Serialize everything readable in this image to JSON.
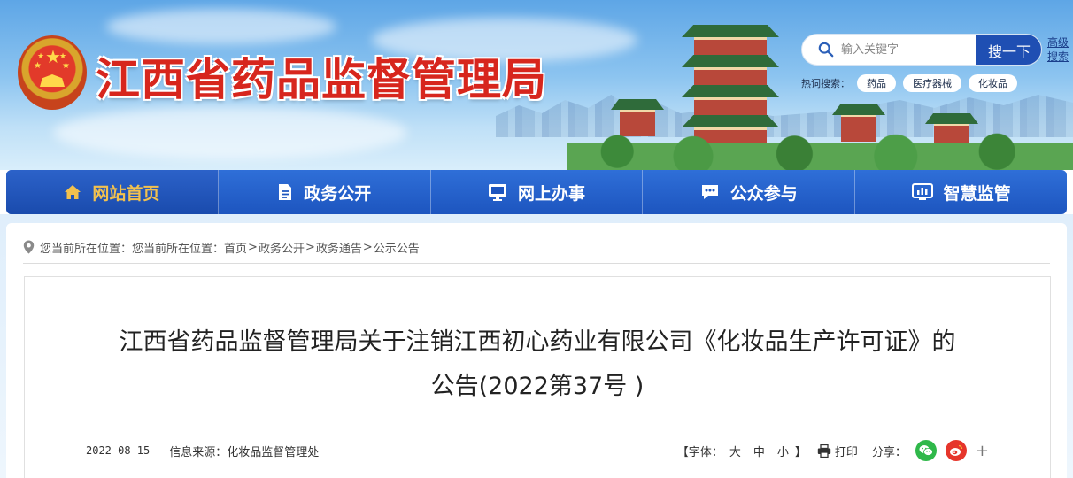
{
  "header": {
    "site_title": "江西省药品监督管理局",
    "emblem_icon": "national-emblem-icon",
    "search": {
      "placeholder": "输入关键字",
      "button_label": "搜一下",
      "advanced_label": "高级搜索"
    },
    "hot_search": {
      "label": "热词搜索：",
      "tags": [
        "药品",
        "医疗器械",
        "化妆品"
      ]
    }
  },
  "nav": {
    "items": [
      {
        "label": "网站首页",
        "icon": "home-icon",
        "active": true
      },
      {
        "label": "政务公开",
        "icon": "document-icon"
      },
      {
        "label": "网上办事",
        "icon": "monitor-icon"
      },
      {
        "label": "公众参与",
        "icon": "chat-icon"
      },
      {
        "label": "智慧监管",
        "icon": "dashboard-icon"
      }
    ]
  },
  "breadcrumb": {
    "prefix": "您当前所在位置：您当前所在位置：",
    "items": [
      "首页",
      "政务公开",
      "政务通告",
      "公示公告"
    ],
    "separator": ">"
  },
  "article": {
    "title_line1": "江西省药品监督管理局关于注销江西初心药业有限公司《化妆品生产许可证》的",
    "title_line2": "公告(2022第37号 )",
    "date": "2022-08-15",
    "source": "信息来源：化妆品监督管理处",
    "font_size_label": "【字体：",
    "font_sizes": [
      "大",
      "中",
      "小"
    ],
    "font_size_close": "】",
    "print_label": "打印",
    "share_label": "分享：",
    "share_more": "+"
  },
  "colors": {
    "title_red": "#d7261d",
    "nav_blue": "#1d55bf",
    "nav_active_text": "#f2c14e",
    "wechat_green": "#2fb84a",
    "weibo_red": "#e6352b"
  }
}
